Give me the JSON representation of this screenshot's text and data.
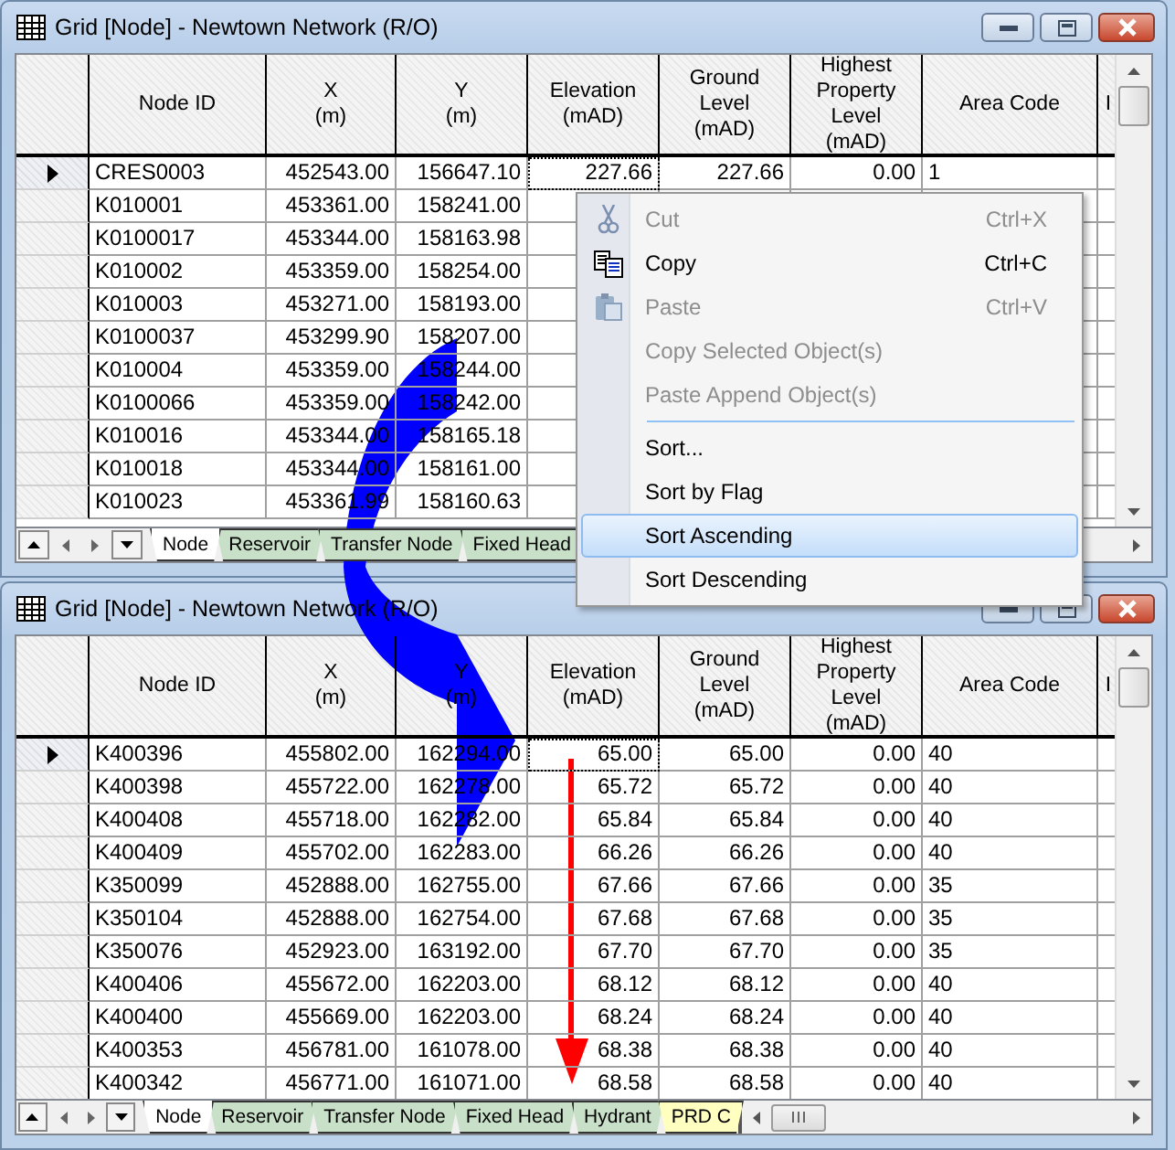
{
  "windows": [
    {
      "title": "Grid [Node] - Newtown Network (R/O)",
      "columns": [
        "Node ID",
        "X\n(m)",
        "Y\n(m)",
        "Elevation\n(mAD)",
        "Ground\nLevel\n(mAD)",
        "Highest\nProperty\nLevel\n(mAD)",
        "Area Code",
        "I"
      ],
      "rows": [
        {
          "selected": true,
          "cells": [
            "CRES0003",
            "452543.00",
            "156647.10",
            "227.66",
            "227.66",
            "0.00",
            "1"
          ]
        },
        {
          "selected": false,
          "cells": [
            "K010001",
            "453361.00",
            "158241.00"
          ]
        },
        {
          "selected": false,
          "cells": [
            "K0100017",
            "453344.00",
            "158163.98"
          ]
        },
        {
          "selected": false,
          "cells": [
            "K010002",
            "453359.00",
            "158254.00"
          ]
        },
        {
          "selected": false,
          "cells": [
            "K010003",
            "453271.00",
            "158193.00"
          ]
        },
        {
          "selected": false,
          "cells": [
            "K0100037",
            "453299.90",
            "158207.00"
          ]
        },
        {
          "selected": false,
          "cells": [
            "K010004",
            "453359.00",
            "158244.00"
          ]
        },
        {
          "selected": false,
          "cells": [
            "K0100066",
            "453359.00",
            "158242.00"
          ]
        },
        {
          "selected": false,
          "cells": [
            "K010016",
            "453344.00",
            "158165.18"
          ]
        },
        {
          "selected": false,
          "cells": [
            "K010018",
            "453344.00",
            "158161.00"
          ]
        },
        {
          "selected": false,
          "cells": [
            "K010023",
            "453361.99",
            "158160.63"
          ]
        }
      ],
      "tabs": [
        {
          "label": "Node",
          "selected": true,
          "color": "#ffffff"
        },
        {
          "label": "Reservoir",
          "selected": false,
          "color": "#c8e0c8"
        },
        {
          "label": "Transfer Node",
          "selected": false,
          "color": "#c8e0c8"
        },
        {
          "label": "Fixed Head",
          "selected": false,
          "color": "#c8e0c8"
        }
      ]
    },
    {
      "title": "Grid [Node] - Newtown Network (R/O)",
      "columns": [
        "Node ID",
        "X\n(m)",
        "Y\n(m)",
        "Elevation\n(mAD)",
        "Ground\nLevel\n(mAD)",
        "Highest\nProperty\nLevel\n(mAD)",
        "Area Code",
        "I"
      ],
      "rows": [
        {
          "selected": true,
          "cells": [
            "K400396",
            "455802.00",
            "162294.00",
            "65.00",
            "65.00",
            "0.00",
            "40"
          ]
        },
        {
          "selected": false,
          "cells": [
            "K400398",
            "455722.00",
            "162278.00",
            "65.72",
            "65.72",
            "0.00",
            "40"
          ]
        },
        {
          "selected": false,
          "cells": [
            "K400408",
            "455718.00",
            "162282.00",
            "65.84",
            "65.84",
            "0.00",
            "40"
          ]
        },
        {
          "selected": false,
          "cells": [
            "K400409",
            "455702.00",
            "162283.00",
            "66.26",
            "66.26",
            "0.00",
            "40"
          ]
        },
        {
          "selected": false,
          "cells": [
            "K350099",
            "452888.00",
            "162755.00",
            "67.66",
            "67.66",
            "0.00",
            "35"
          ]
        },
        {
          "selected": false,
          "cells": [
            "K350104",
            "452888.00",
            "162754.00",
            "67.68",
            "67.68",
            "0.00",
            "35"
          ]
        },
        {
          "selected": false,
          "cells": [
            "K350076",
            "452923.00",
            "163192.00",
            "67.70",
            "67.70",
            "0.00",
            "35"
          ]
        },
        {
          "selected": false,
          "cells": [
            "K400406",
            "455672.00",
            "162203.00",
            "68.12",
            "68.12",
            "0.00",
            "40"
          ]
        },
        {
          "selected": false,
          "cells": [
            "K400400",
            "455669.00",
            "162203.00",
            "68.24",
            "68.24",
            "0.00",
            "40"
          ]
        },
        {
          "selected": false,
          "cells": [
            "K400353",
            "456781.00",
            "161078.00",
            "68.38",
            "68.38",
            "0.00",
            "40"
          ]
        },
        {
          "selected": false,
          "cells": [
            "K400342",
            "456771.00",
            "161071.00",
            "68.58",
            "68.58",
            "0.00",
            "40"
          ]
        }
      ],
      "tabs": [
        {
          "label": "Node",
          "selected": true,
          "color": "#ffffff"
        },
        {
          "label": "Reservoir",
          "selected": false,
          "color": "#c8e0c8"
        },
        {
          "label": "Transfer Node",
          "selected": false,
          "color": "#c8e0c8"
        },
        {
          "label": "Fixed Head",
          "selected": false,
          "color": "#c8e0c8"
        },
        {
          "label": "Hydrant",
          "selected": false,
          "color": "#c8e0c8"
        },
        {
          "label": "PRD C",
          "selected": false,
          "color": "#ffffc0"
        }
      ]
    }
  ],
  "context_menu": {
    "items": [
      {
        "kind": "item",
        "label": "Cut",
        "shortcut": "Ctrl+X",
        "disabled": true,
        "selected": false
      },
      {
        "kind": "item",
        "label": "Copy",
        "shortcut": "Ctrl+C",
        "disabled": false,
        "selected": false
      },
      {
        "kind": "item",
        "label": "Paste",
        "shortcut": "Ctrl+V",
        "disabled": true,
        "selected": false
      },
      {
        "kind": "item",
        "label": "Copy Selected Object(s)",
        "disabled": true,
        "selected": false
      },
      {
        "kind": "item",
        "label": "Paste Append Object(s)",
        "disabled": true,
        "selected": false
      },
      {
        "kind": "separator"
      },
      {
        "kind": "item",
        "label": "Sort...",
        "disabled": false,
        "selected": false
      },
      {
        "kind": "item",
        "label": "Sort by Flag",
        "disabled": false,
        "selected": false
      },
      {
        "kind": "item",
        "label": "Sort Ascending",
        "disabled": false,
        "selected": true
      },
      {
        "kind": "item",
        "label": "Sort Descending",
        "disabled": false,
        "selected": false
      }
    ]
  }
}
